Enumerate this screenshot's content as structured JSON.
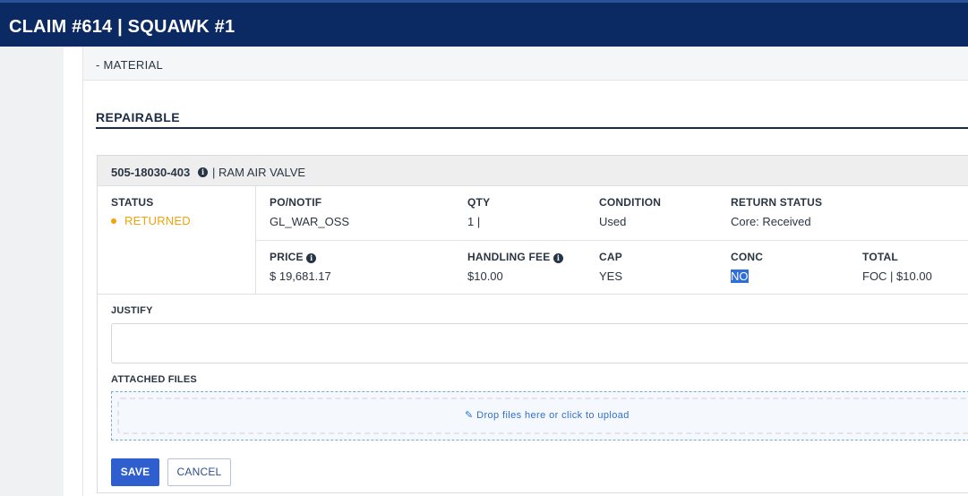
{
  "header": {
    "title": "CLAIM #614 | SQUAWK #1"
  },
  "material": {
    "label": "- MATERIAL"
  },
  "section": {
    "title": "REPAIRABLE"
  },
  "part": {
    "number": "505-18030-403",
    "separator": "|",
    "description": "RAM AIR VALVE"
  },
  "status": {
    "label": "STATUS",
    "value": "RETURNED"
  },
  "fields_row1": {
    "po_label": "PO/NOTIF",
    "po_value": "GL_WAR_OSS",
    "qty_label": "QTY",
    "qty_value": "1 |",
    "condition_label": "CONDITION",
    "condition_value": "Used",
    "return_label": "RETURN STATUS",
    "return_value": "Core: Received"
  },
  "fields_row2": {
    "price_label": "PRICE",
    "price_value": "$ 19,681.17",
    "fee_label": "HANDLING FEE",
    "fee_value": "$10.00",
    "cap_label": "CAP",
    "cap_value": "YES",
    "conc_label": "CONC",
    "conc_value": "NO",
    "total_label": "TOTAL",
    "total_value": "FOC | $10.00"
  },
  "justify": {
    "label": "JUSTIFY",
    "value": ""
  },
  "files": {
    "label": "ATTACHED FILES",
    "drop_text": "Drop files here or click to upload",
    "drop_icon": "paperclip-icon"
  },
  "actions": {
    "save": "SAVE",
    "cancel": "CANCEL"
  },
  "colors": {
    "header": "#0b2a63",
    "status": "#f0a30a",
    "primary": "#2f5fcf",
    "link": "#2f6fd6"
  }
}
